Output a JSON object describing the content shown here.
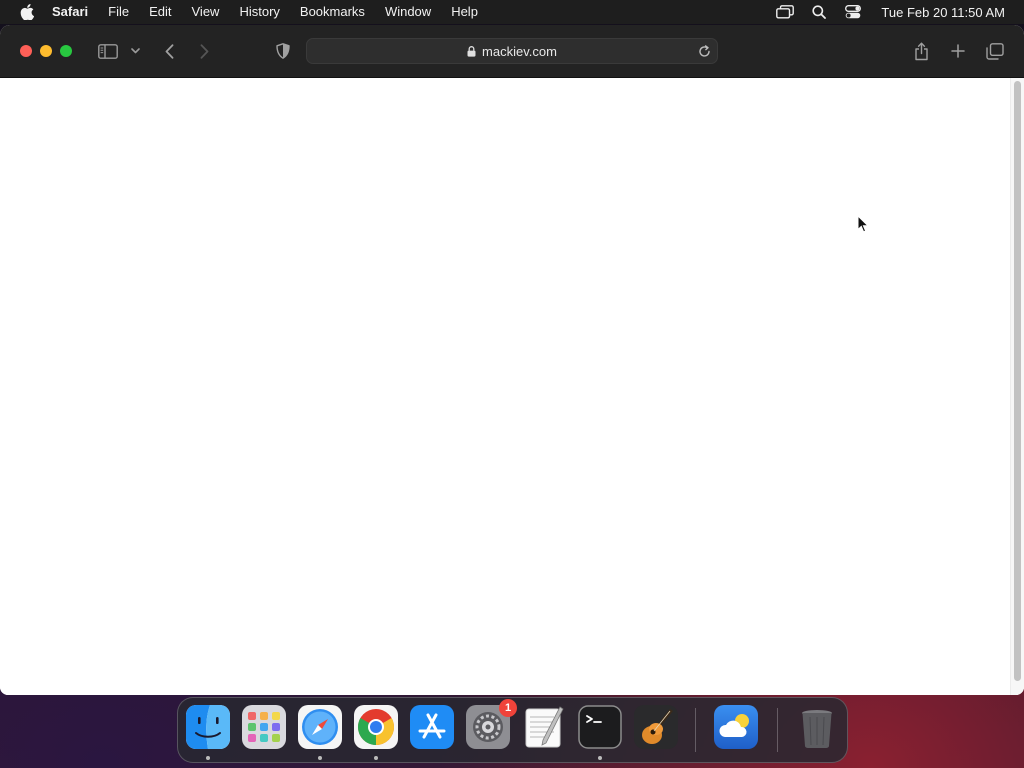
{
  "menubar": {
    "app_name": "Safari",
    "items": [
      "File",
      "Edit",
      "View",
      "History",
      "Bookmarks",
      "Window",
      "Help"
    ],
    "status_icons": [
      "screen-mirroring-icon",
      "spotlight-search-icon",
      "control-center-icon"
    ],
    "clock": "Tue Feb 20  11:50 AM"
  },
  "browser": {
    "address": "mackiev.com",
    "secure": true,
    "toolbar_icons": [
      "sidebar-icon",
      "chevron-down-icon",
      "back-icon",
      "forward-icon",
      "privacy-shield-icon",
      "share-icon",
      "new-tab-icon",
      "tab-overview-icon"
    ],
    "page_content": ""
  },
  "dock": {
    "apps": [
      {
        "name": "Finder",
        "icon": "finder-icon",
        "running": true
      },
      {
        "name": "Launchpad",
        "icon": "launchpad-icon",
        "running": false
      },
      {
        "name": "Safari",
        "icon": "safari-icon",
        "running": true
      },
      {
        "name": "Google Chrome",
        "icon": "chrome-icon",
        "running": true
      },
      {
        "name": "App Store",
        "icon": "app-store-icon",
        "running": false
      },
      {
        "name": "System Settings",
        "icon": "system-settings-icon",
        "running": false,
        "badge": "1"
      },
      {
        "name": "TextEdit",
        "icon": "textedit-icon",
        "running": false
      },
      {
        "name": "Terminal",
        "icon": "terminal-icon",
        "running": true
      },
      {
        "name": "GarageBand",
        "icon": "garageband-icon",
        "running": false
      },
      {
        "name": "Weather",
        "icon": "weather-icon",
        "running": false
      },
      {
        "name": "Trash",
        "icon": "trash-icon",
        "running": false
      }
    ]
  }
}
